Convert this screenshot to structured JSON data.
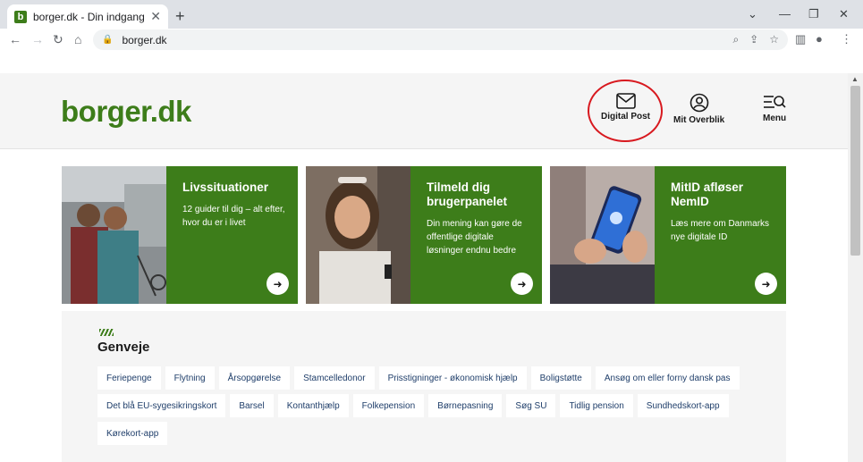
{
  "browser": {
    "tab_title": "borger.dk - Din indgang til det o",
    "favicon_letter": "b",
    "tab_close": "✕",
    "new_tab": "+",
    "url": "borger.dk"
  },
  "site": {
    "logo": "borger.dk",
    "nav": [
      {
        "label": "Digital Post",
        "icon": "envelope-icon"
      },
      {
        "label": "Mit Overblik",
        "icon": "user-circle-icon"
      },
      {
        "label": "Menu",
        "icon": "menu-search-icon"
      }
    ]
  },
  "cards": [
    {
      "title": "Livssituationer",
      "text": "12 guider til dig – alt efter, hvor du er i livet"
    },
    {
      "title": "Tilmeld dig brugerpanelet",
      "text": "Din mening kan gøre de offentlige digitale løsninger endnu bedre"
    },
    {
      "title": "MitID afløser NemID",
      "text": "Læs mere om Danmarks nye digitale ID"
    }
  ],
  "shortcuts": {
    "title": "Genveje",
    "rows": [
      [
        "Feriepenge",
        "Flytning",
        "Årsopgørelse",
        "Stamcelledonor",
        "Prisstigninger - økonomisk hjælp",
        "Boligstøtte",
        "Ansøg om eller forny dansk pas"
      ],
      [
        "Det blå EU-sygesikringskort",
        "Barsel",
        "Kontanthjælp",
        "Folkepension",
        "Børnepasning",
        "Søg SU",
        "Tidlig pension",
        "Sundhedskort-app"
      ],
      [
        "Kørekort-app"
      ]
    ]
  },
  "colors": {
    "brand_green": "#3d7d1a",
    "highlight_red": "#d8191f"
  }
}
